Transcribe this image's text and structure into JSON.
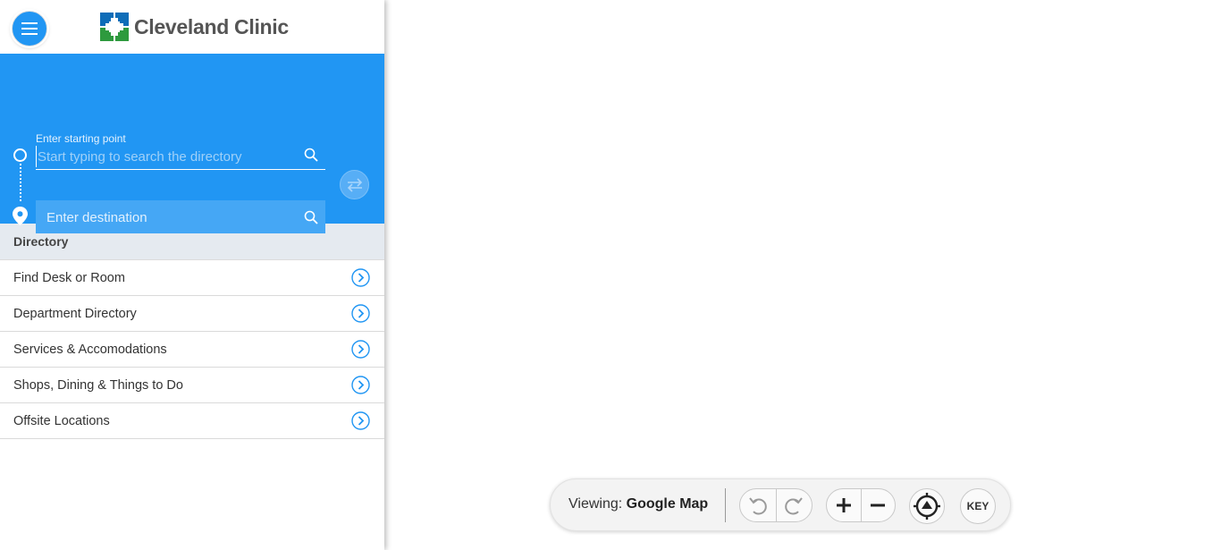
{
  "app": {
    "logo_text": "Cleveland Clinic",
    "brand_color": "#2196f3"
  },
  "search": {
    "start_label": "Enter starting point",
    "start_placeholder": "Start typing to search the directory",
    "start_value": "",
    "destination_placeholder": "Enter destination",
    "destination_value": ""
  },
  "directory": {
    "header": "Directory",
    "items": [
      {
        "label": "Find Desk or Room"
      },
      {
        "label": "Department Directory"
      },
      {
        "label": "Services & Accomodations"
      },
      {
        "label": "Shops, Dining & Things to Do"
      },
      {
        "label": "Offsite Locations"
      }
    ]
  },
  "map_toolbar": {
    "viewing_prefix": "Viewing:",
    "viewing_value": "Google Map",
    "key_label": "KEY",
    "icons": [
      "undo-icon",
      "redo-icon",
      "zoom-in-icon",
      "zoom-out-icon",
      "locate-icon"
    ]
  }
}
